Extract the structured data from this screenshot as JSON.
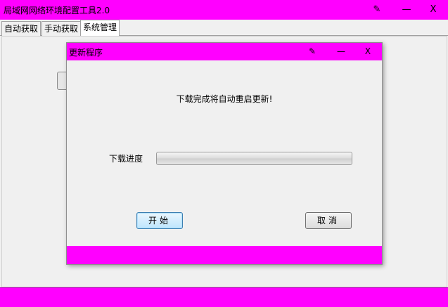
{
  "window": {
    "title": "局域网网络环境配置工具2.0",
    "pin_glyph": "✎",
    "minimize_glyph": "—",
    "close_glyph": "X",
    "accent_color": "#ff00ff"
  },
  "tabs": [
    {
      "label": "自动获取",
      "active": false
    },
    {
      "label": "手动获取",
      "active": false
    },
    {
      "label": "系统管理",
      "active": true
    }
  ],
  "dialog": {
    "title": "更新程序",
    "pin_glyph": "✎",
    "minimize_glyph": "—",
    "close_glyph": "X",
    "message": "下载完成将自动重启更新!",
    "progress_label": "下载进度",
    "progress_value": 0,
    "start_label": "开始",
    "cancel_label": "取消"
  },
  "icons": {
    "pin": "pin-icon",
    "minimize": "minimize-icon",
    "close": "close-icon"
  }
}
